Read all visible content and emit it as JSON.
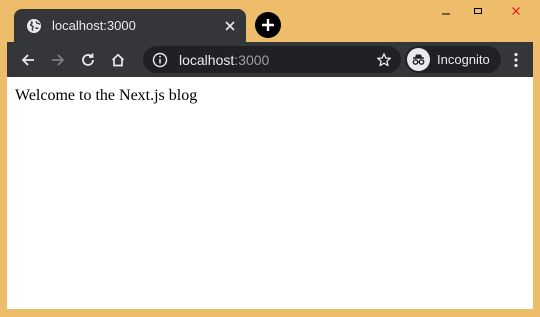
{
  "tab": {
    "title": "localhost:3000"
  },
  "omnibox": {
    "host": "localhost",
    "port": ":3000"
  },
  "profile": {
    "label": "Incognito"
  },
  "page": {
    "text": "Welcome to the Next.js blog"
  },
  "colors": {
    "frame": "#eebd6c",
    "toolbar": "#35363a",
    "omnibox": "#202124",
    "close_accent": "#e81123"
  }
}
